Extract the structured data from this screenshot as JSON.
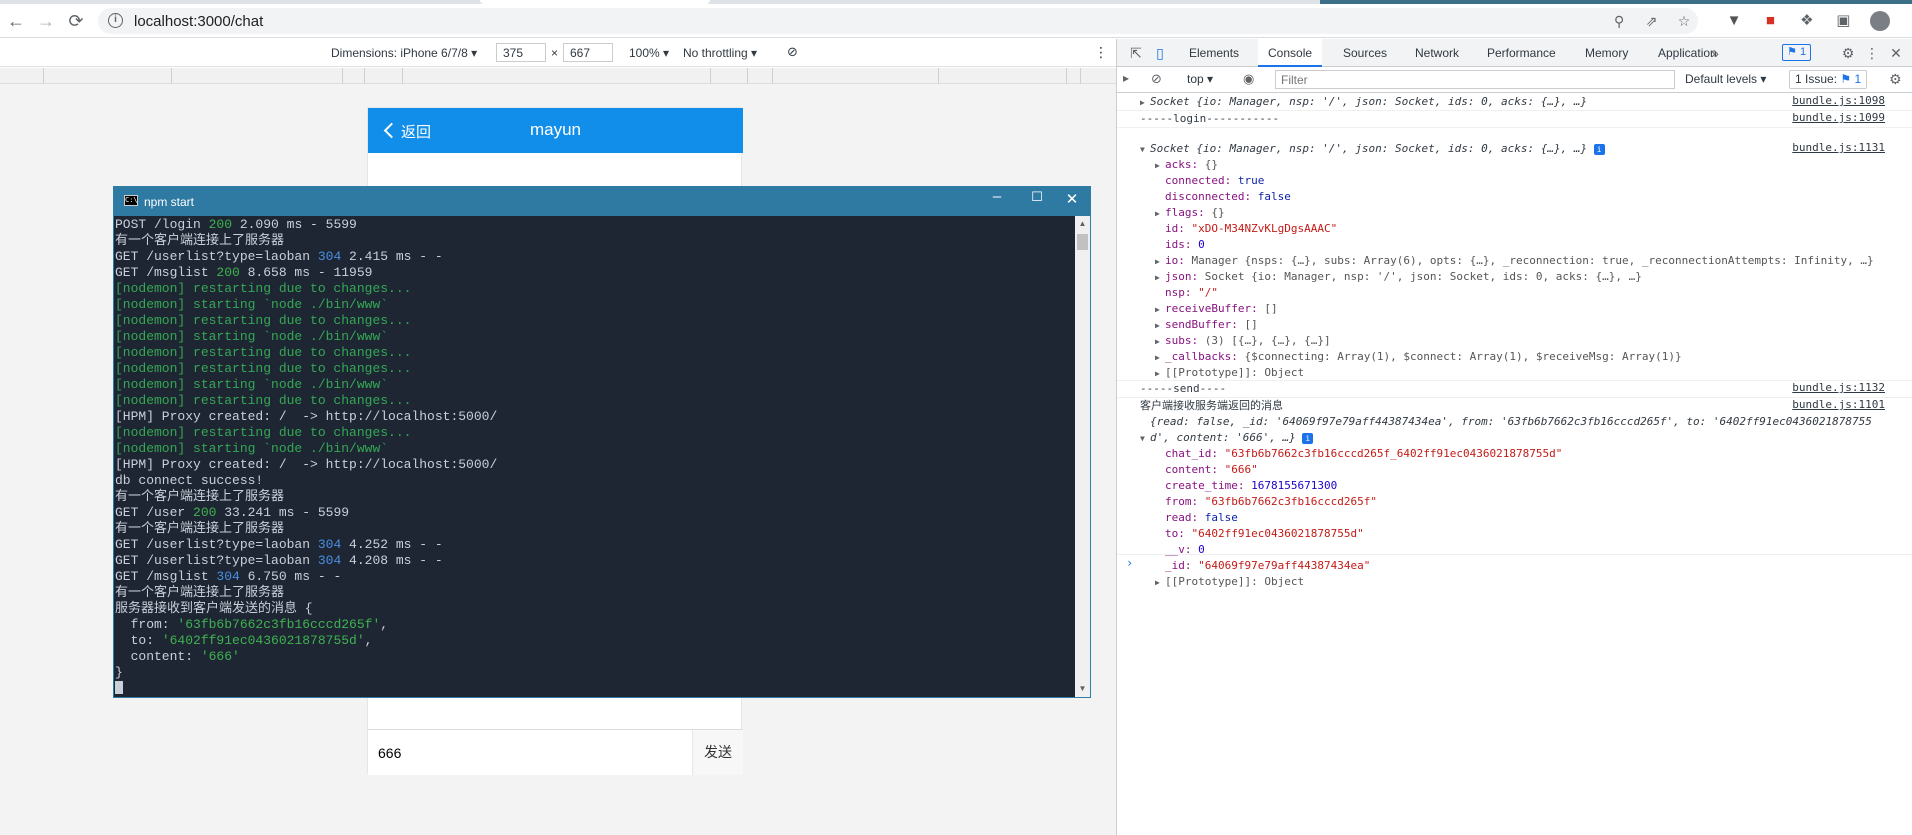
{
  "browser": {
    "url": "localhost:3000/chat",
    "back_icon": "←",
    "forward_icon": "→",
    "reload_icon": "⟳"
  },
  "device_toolbar": {
    "dimensions_label": "Dimensions: iPhone 6/7/8",
    "width": "375",
    "times": "×",
    "height": "667",
    "zoom": "100%",
    "throttling": "No throttling"
  },
  "phone": {
    "back_label": "返回",
    "title": "mayun",
    "input_value": "666",
    "send_label": "发送",
    "header_color": "#108ee9"
  },
  "terminal": {
    "title": "npm start",
    "icon_text": "C:\\",
    "lines": [
      [
        {
          "t": "POST /login ",
          "c": "c-gray"
        },
        {
          "t": "200",
          "c": "c-green"
        },
        {
          "t": " 2.090 ms - 5599",
          "c": "c-gray"
        }
      ],
      [
        {
          "t": "有一个客户端连接上了服务器",
          "c": "c-gray"
        }
      ],
      [
        {
          "t": "GET /userlist?type=laoban ",
          "c": "c-gray"
        },
        {
          "t": "304",
          "c": "c-blue"
        },
        {
          "t": " 2.415 ms - -",
          "c": "c-gray"
        }
      ],
      [
        {
          "t": "GET /msglist ",
          "c": "c-gray"
        },
        {
          "t": "200",
          "c": "c-green"
        },
        {
          "t": " 8.658 ms - 11959",
          "c": "c-gray"
        }
      ],
      [
        {
          "t": "[nodemon] restarting due to changes...",
          "c": "c-nodemon"
        }
      ],
      [
        {
          "t": "[nodemon] starting `node ./bin/www`",
          "c": "c-nodemon"
        }
      ],
      [
        {
          "t": "[nodemon] restarting due to changes...",
          "c": "c-nodemon"
        }
      ],
      [
        {
          "t": "[nodemon] starting `node ./bin/www`",
          "c": "c-nodemon"
        }
      ],
      [
        {
          "t": "[nodemon] restarting due to changes...",
          "c": "c-nodemon"
        }
      ],
      [
        {
          "t": "[nodemon] restarting due to changes...",
          "c": "c-nodemon"
        }
      ],
      [
        {
          "t": "[nodemon] starting `node ./bin/www`",
          "c": "c-nodemon"
        }
      ],
      [
        {
          "t": "[nodemon] restarting due to changes...",
          "c": "c-nodemon"
        }
      ],
      [
        {
          "t": "[HPM] Proxy created: /  -> http://localhost:5000/",
          "c": "c-gray"
        }
      ],
      [
        {
          "t": "[nodemon] restarting due to changes...",
          "c": "c-nodemon"
        }
      ],
      [
        {
          "t": "[nodemon] starting `node ./bin/www`",
          "c": "c-nodemon"
        }
      ],
      [
        {
          "t": "[HPM] Proxy created: /  -> http://localhost:5000/",
          "c": "c-gray"
        }
      ],
      [
        {
          "t": "db connect success!",
          "c": "c-gray"
        }
      ],
      [
        {
          "t": "有一个客户端连接上了服务器",
          "c": "c-gray"
        }
      ],
      [
        {
          "t": "GET /user ",
          "c": "c-gray"
        },
        {
          "t": "200",
          "c": "c-green"
        },
        {
          "t": " 33.241 ms - 5599",
          "c": "c-gray"
        }
      ],
      [
        {
          "t": "有一个客户端连接上了服务器",
          "c": "c-gray"
        }
      ],
      [
        {
          "t": "GET /userlist?type=laoban ",
          "c": "c-gray"
        },
        {
          "t": "304",
          "c": "c-blue"
        },
        {
          "t": " 4.252 ms - -",
          "c": "c-gray"
        }
      ],
      [
        {
          "t": "GET /userlist?type=laoban ",
          "c": "c-gray"
        },
        {
          "t": "304",
          "c": "c-blue"
        },
        {
          "t": " 4.208 ms - -",
          "c": "c-gray"
        }
      ],
      [
        {
          "t": "GET /msglist ",
          "c": "c-gray"
        },
        {
          "t": "304",
          "c": "c-blue"
        },
        {
          "t": " 6.750 ms - -",
          "c": "c-gray"
        }
      ],
      [
        {
          "t": "有一个客户端连接上了服务器",
          "c": "c-gray"
        }
      ],
      [
        {
          "t": "服务器接收到客户端发送的消息 {",
          "c": "c-gray"
        }
      ],
      [
        {
          "t": "  from: ",
          "c": "c-gray"
        },
        {
          "t": "'63fb6b7662c3fb16cccd265f'",
          "c": "c-green"
        },
        {
          "t": ",",
          "c": "c-gray"
        }
      ],
      [
        {
          "t": "  to: ",
          "c": "c-gray"
        },
        {
          "t": "'6402ff91ec0436021878755d'",
          "c": "c-green"
        },
        {
          "t": ",",
          "c": "c-gray"
        }
      ],
      [
        {
          "t": "  content: ",
          "c": "c-gray"
        },
        {
          "t": "'666'",
          "c": "c-green"
        }
      ],
      [
        {
          "t": "}",
          "c": "c-gray"
        }
      ]
    ]
  },
  "devtools": {
    "tabs": [
      "Elements",
      "Console",
      "Sources",
      "Network",
      "Performance",
      "Memory",
      "Application"
    ],
    "active_tab": "Console",
    "messages_badge": "1",
    "context": "top",
    "filter_placeholder": "Filter",
    "levels": "Default levels",
    "issues": "1 Issue:",
    "issues_count": "1",
    "console": {
      "socket_summary": "Socket {io: Manager, nsp: '/', json: Socket, ids: 0, acks: {…}, …}",
      "src1": "bundle.js:1098",
      "login_line": "-----login-----------",
      "src2": "bundle.js:1099",
      "src3": "bundle.js:1131",
      "socket_props": [
        {
          "k": "acks",
          "v": "{}",
          "vc": "kd",
          "exp": true
        },
        {
          "k": "connected",
          "v": "true",
          "vc": "b",
          "exp": false
        },
        {
          "k": "disconnected",
          "v": "false",
          "vc": "b",
          "exp": false
        },
        {
          "k": "flags",
          "v": "{}",
          "vc": "kd",
          "exp": true
        },
        {
          "k": "id",
          "v": "\"xDO-M34NZvKLgDgsAAAC\"",
          "vc": "s",
          "exp": false
        },
        {
          "k": "ids",
          "v": "0",
          "vc": "n",
          "exp": false
        },
        {
          "k": "io",
          "v": "Manager {nsps: {…}, subs: Array(6), opts: {…}, _reconnection: true, _reconnectionAttempts: Infinity, …}",
          "vc": "kd",
          "exp": true
        },
        {
          "k": "json",
          "v": "Socket {io: Manager, nsp: '/', json: Socket, ids: 0, acks: {…}, …}",
          "vc": "kd",
          "exp": true
        },
        {
          "k": "nsp",
          "v": "\"/\"",
          "vc": "s",
          "exp": false
        },
        {
          "k": "receiveBuffer",
          "v": "[]",
          "vc": "kd",
          "exp": true
        },
        {
          "k": "sendBuffer",
          "v": "[]",
          "vc": "kd",
          "exp": true
        },
        {
          "k": "subs",
          "v": "(3) [{…}, {…}, {…}]",
          "vc": "kd",
          "exp": true
        },
        {
          "k": "_callbacks",
          "v": "{$connecting: Array(1), $connect: Array(1), $receiveMsg: Array(1)}",
          "vc": "kd",
          "exp": true
        },
        {
          "k": "[[Prototype]]",
          "v": "Object",
          "vc": "kd",
          "exp": true
        }
      ],
      "send_line": "-----send----",
      "src4": "bundle.js:1132",
      "receive_label": "客户端接收服务端返回的消息",
      "src5": "bundle.js:1101",
      "msg_summary_1": "{read: false, _id: '64069f97e79aff44387434ea', from: '63fb6b7662c3fb16cccd265f', to: '6402ff91ec0436021878755",
      "msg_summary_2": "d', content: '666', …}",
      "msg_props": [
        {
          "k": "chat_id",
          "v": "\"63fb6b7662c3fb16cccd265f_6402ff91ec0436021878755d\"",
          "vc": "s"
        },
        {
          "k": "content",
          "v": "\"666\"",
          "vc": "s"
        },
        {
          "k": "create_time",
          "v": "1678155671300",
          "vc": "n"
        },
        {
          "k": "from",
          "v": "\"63fb6b7662c3fb16cccd265f\"",
          "vc": "s"
        },
        {
          "k": "read",
          "v": "false",
          "vc": "b"
        },
        {
          "k": "to",
          "v": "\"6402ff91ec0436021878755d\"",
          "vc": "s"
        },
        {
          "k": "__v",
          "v": "0",
          "vc": "n"
        },
        {
          "k": "_id",
          "v": "\"64069f97e79aff44387434ea\"",
          "vc": "s"
        }
      ],
      "proto_line": "[[Prototype]]: Object"
    }
  }
}
